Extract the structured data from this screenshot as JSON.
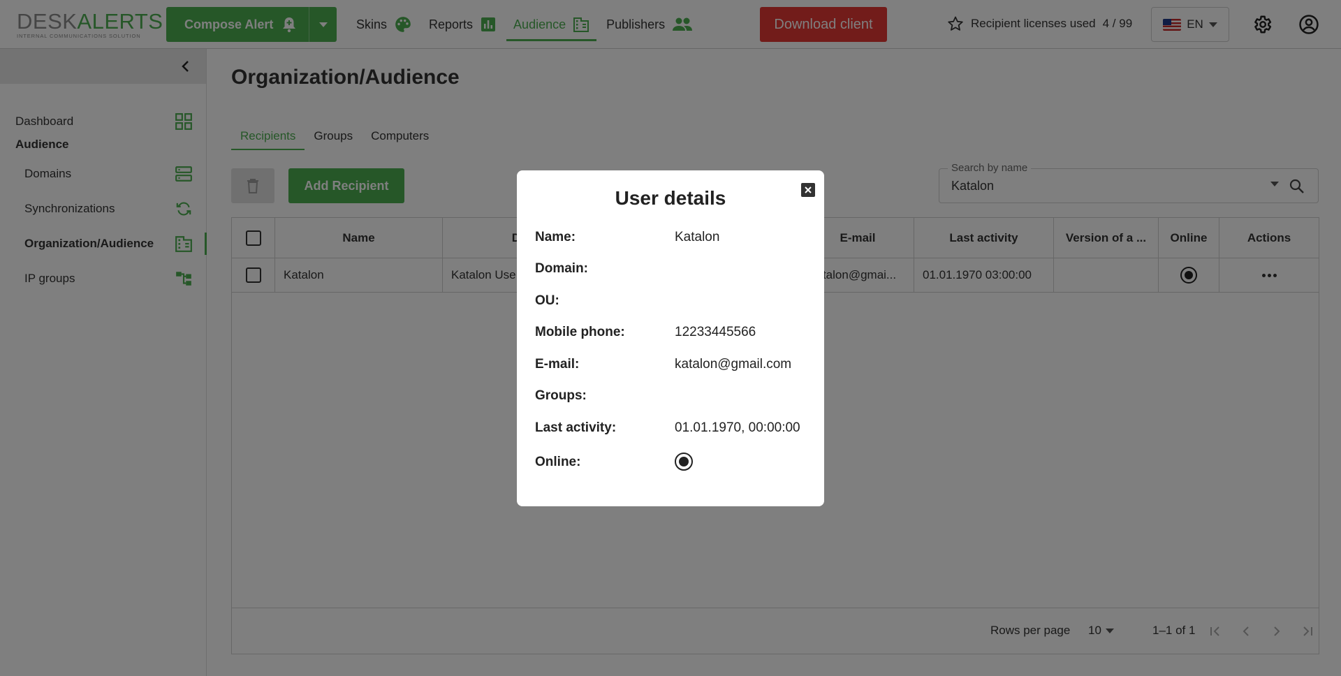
{
  "app": {
    "logo_primary": "DESK",
    "logo_accent": "ALERTS",
    "logo_tagline": "INTERNAL COMMUNICATIONS SOLUTION",
    "brand_color": "#4caf50",
    "danger_color": "#e53935"
  },
  "topbar": {
    "compose_label": "Compose Alert",
    "compose_icon": "bell-plus-icon",
    "nav": [
      {
        "label": "Skins",
        "icon": "palette-icon",
        "active": false
      },
      {
        "label": "Reports",
        "icon": "bar-chart-icon",
        "active": false
      },
      {
        "label": "Audience",
        "icon": "organization-icon",
        "active": true
      },
      {
        "label": "Publishers",
        "icon": "people-icon",
        "active": false
      }
    ],
    "download_label": "Download client",
    "licenses_label": "Recipient licenses used",
    "licenses_value": "4 / 99",
    "language": "EN"
  },
  "sidebar": {
    "dashboard": "Dashboard",
    "section": "Audience",
    "items": [
      {
        "label": "Domains",
        "icon": "domains-icon"
      },
      {
        "label": "Synchronizations",
        "icon": "sync-icon"
      },
      {
        "label": "Organization/Audience",
        "icon": "organization-icon",
        "active": true
      },
      {
        "label": "IP groups",
        "icon": "ip-groups-icon"
      }
    ]
  },
  "main": {
    "title": "Organization/Audience",
    "tabs": [
      "Recipients",
      "Groups",
      "Computers"
    ],
    "active_tab": "Recipients",
    "add_label": "Add Recipient",
    "search": {
      "legend": "Search by name",
      "value": "Katalon"
    },
    "table": {
      "headers": [
        "Name",
        "Displ",
        "",
        "E-mail",
        "Last activity",
        "Version of a ...",
        "Online",
        "Actions"
      ],
      "rows": [
        {
          "name": "Katalon",
          "display": "Katalon Use",
          "hidden": "",
          "email": "katalon@gmai...",
          "last_activity": "01.01.1970 03:00:00",
          "version": "",
          "online": true
        }
      ]
    },
    "pagination": {
      "rows_per_page_label": "Rows per page",
      "rows_per_page": "10",
      "range": "1–1 of 1"
    }
  },
  "modal": {
    "title": "User details",
    "fields": [
      {
        "label": "Name:",
        "value": "Katalon"
      },
      {
        "label": "Domain:",
        "value": ""
      },
      {
        "label": "OU:",
        "value": ""
      },
      {
        "label": "Mobile phone:",
        "value": "12233445566"
      },
      {
        "label": "E-mail:",
        "value": "katalon@gmail.com"
      },
      {
        "label": "Groups:",
        "value": ""
      },
      {
        "label": "Last activity:",
        "value": "01.01.1970, 00:00:00"
      },
      {
        "label": "Online:",
        "value": ""
      }
    ],
    "online": true
  }
}
